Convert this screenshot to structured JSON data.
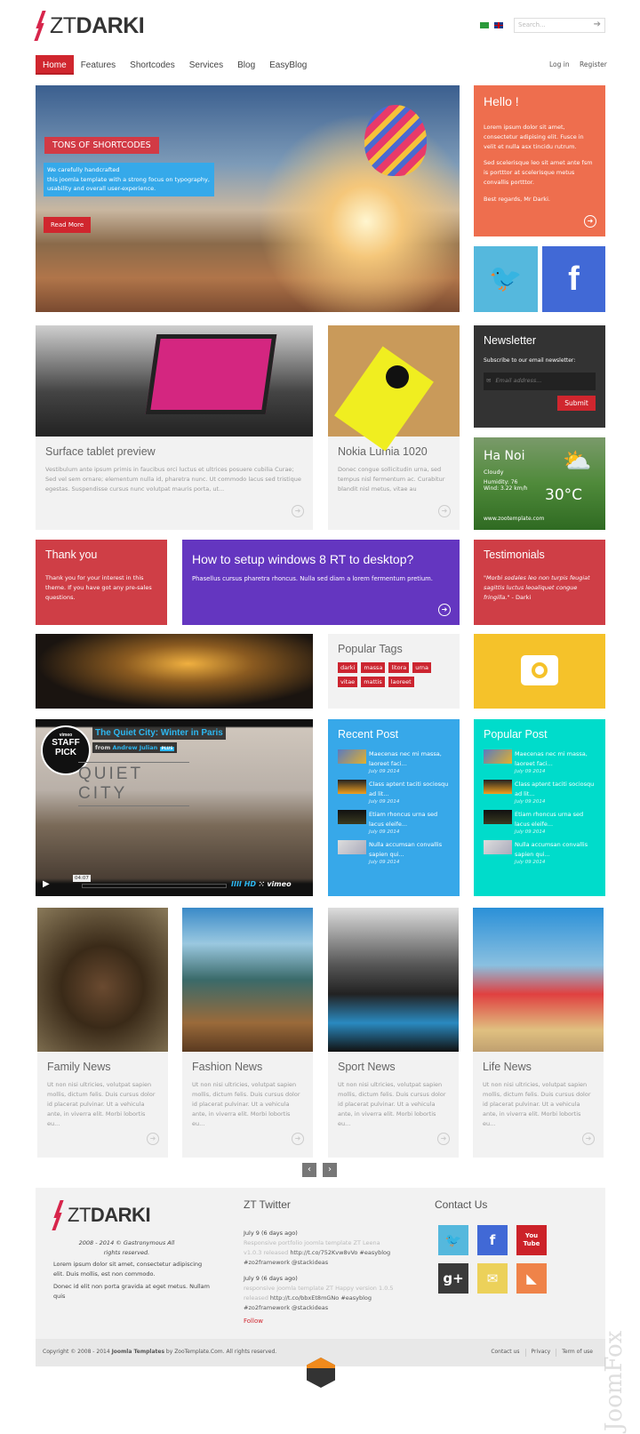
{
  "header": {
    "logo_light": "ZT",
    "logo_bold": "DARKI",
    "search_placeholder": "Search...",
    "flags": [
      "arabic-flag",
      "english-flag"
    ]
  },
  "nav": {
    "items": [
      "Home",
      "Features",
      "Shortcodes",
      "Services",
      "Blog",
      "EasyBlog"
    ],
    "active": "Home",
    "login": "Log in",
    "register": "Register"
  },
  "hero": {
    "badge": "TONS OF SHORTCODES",
    "caption_lines": [
      "We carefully handcrafted",
      "this joomla template with a strong focus on typography,",
      "usability and overall user-experience."
    ],
    "button": "Read More"
  },
  "hello": {
    "title": "Hello !",
    "p1": "Lorem ipsum dolor sit amet, consectetur adipising elit. Fusce in velit et nulla asx tincidu rutrum.",
    "p2": "Sed scelerisque leo sit amet ante fsm is portttor at scelerisque metus convallis portttor.",
    "p3": "Best regards, Mr Darki.",
    "color": "#ee6e4e"
  },
  "social": {
    "twitter_color": "#55b8dd",
    "facebook_color": "#4169d6"
  },
  "articles": [
    {
      "title": "Surface tablet preview",
      "text": "Vestibulum ante ipsum primis in faucibus orci luctus et ultrices posuere cubilia Curae; Sed vel sem ornare; elementum nulla id, pharetra nunc. Ut commodo lacus sed tristique egestas. Suspendisse cursus nunc volutpat mauris porta, ut..."
    },
    {
      "title": "Nokia Lumia 1020",
      "text": "Donec congue sollicitudin urna, sed tempus nisl fermentum ac. Curabitur blandit nisl metus, vitae au"
    }
  ],
  "newsletter": {
    "title": "Newsletter",
    "subtitle": "Subscribe to our email newsletter:",
    "placeholder": "Email address...",
    "submit": "Submit"
  },
  "weather": {
    "city": "Ha Noi",
    "condition": "Cloudy",
    "humidity": "Humidity: 76",
    "wind": "Wind: 3.22 km/h",
    "temp": "30°C",
    "site": "www.zootemplate.com"
  },
  "thankyou": {
    "title": "Thank you",
    "text": "Thank you for your interest in this theme. If you have got any pre-sales questions."
  },
  "howto": {
    "title": "How to setup windows 8 RT to desktop?",
    "text": "Phasellus cursus pharetra rhoncus. Nulla sed diam a lorem fermentum pretium."
  },
  "testimonials": {
    "title": "Testimonials",
    "quote": "\"Morbi sodales leo non turpis feugiat sagittis luctus leoaliquet congue fringilla.\"",
    "author": " - Darki"
  },
  "tags": {
    "title": "Popular Tags",
    "items": [
      "darki",
      "massa",
      "litora",
      "urna",
      "vitae",
      "mattis",
      "laoreet"
    ]
  },
  "video": {
    "title": "The Quiet City: Winter in Paris",
    "from": "from",
    "author": "Andrew Julian",
    "plus": "PLUS",
    "badge_top": "vimeo",
    "badge": "STAFF PICK",
    "overlay": "QUIET CITY",
    "time": "04:07",
    "hd": "HD",
    "brand": "vimeo"
  },
  "recent": {
    "title": "Recent Post",
    "items": [
      {
        "t": "Maecenas nec mi massa, laoreet faci...",
        "d": "July 09 2014"
      },
      {
        "t": "Class aptent taciti sociosqu ad lit...",
        "d": "July 09 2014"
      },
      {
        "t": "Etiam rhoncus urna sed lacus eleife...",
        "d": "July 09 2014"
      },
      {
        "t": "Nulla accumsan convallis sapien qui...",
        "d": "July 09 2014"
      }
    ]
  },
  "popular": {
    "title": "Popular Post",
    "items": [
      {
        "t": "Maecenas nec mi massa, laoreet faci...",
        "d": "July 09 2014"
      },
      {
        "t": "Class aptent taciti sociosqu ad lit...",
        "d": "July 09 2014"
      },
      {
        "t": "Etiam rhoncus urna sed lacus eleife...",
        "d": "July 09 2014"
      },
      {
        "t": "Nulla accumsan convallis sapien qui...",
        "d": "July 09 2014"
      }
    ]
  },
  "news": [
    {
      "title": "Family News",
      "text": "Ut non nisi ultricies, volutpat sapien mollis, dictum felis. Duis cursus dolor id placerat pulvinar. Ut a vehicula ante, in viverra elit. Morbi lobortis eu..."
    },
    {
      "title": "Fashion News",
      "text": "Ut non nisi ultricies, volutpat sapien mollis, dictum felis. Duis cursus dolor id placerat pulvinar. Ut a vehicula ante, in viverra elit. Morbi lobortis eu..."
    },
    {
      "title": "Sport News",
      "text": "Ut non nisi ultricies, volutpat sapien mollis, dictum felis. Duis cursus dolor id placerat pulvinar. Ut a vehicula ante, in viverra elit. Morbi lobortis eu..."
    },
    {
      "title": "Life News",
      "text": "Ut non nisi ultricies, volutpat sapien mollis, dictum felis. Duis cursus dolor id placerat pulvinar. Ut a vehicula ante, in viverra elit. Morbi lobortis eu..."
    }
  ],
  "pager": {
    "prev": "‹",
    "next": "›"
  },
  "footer": {
    "rights": "2008 - 2014 © Gastronymous All rights reserved.",
    "p1": "Lorem ipsum dolor sit amet, consectetur adipiscing elit. Duis mollis, est non commodo.",
    "p2": "Donec id elit non porta gravida at eget metus. Nullam quis",
    "twitter_title": "ZT Twitter",
    "tweets": [
      {
        "date": "July 9 (6 days ago)",
        "text": "Responsive portfolio joomla template ZT Leena v1.0.3 released",
        "link": "http://t.co/752Kvw8vVo #easyblog #zo2framework @stackideas"
      },
      {
        "date": "July 9 (6 days ago)",
        "text": "responsive joomla template ZT Happy version 1.0.5 released",
        "link": "http://t.co/bbxEt8mGNo #easyblog #zo2framework @stackideas"
      }
    ],
    "follow": "Follow",
    "contact_title": "Contact Us",
    "contact_icons": [
      {
        "name": "twitter",
        "glyph": "🐦",
        "color": "#55b8dd"
      },
      {
        "name": "facebook",
        "glyph": "f",
        "color": "#4169d6"
      },
      {
        "name": "youtube",
        "glyph": "You Tube",
        "color": "#cc2229"
      },
      {
        "name": "google-plus",
        "glyph": "g+",
        "color": "#3a3a3a"
      },
      {
        "name": "email",
        "glyph": "✉",
        "color": "#ecd15a"
      },
      {
        "name": "rss",
        "glyph": "◣",
        "color": "#ef8349"
      }
    ],
    "copyright_pre": "Copyright © 2008 - 2014 ",
    "copyright_bold": "Joomla Templates",
    "copyright_post": " by ZooTemplate.Com. All rights reserved.",
    "links": [
      "Contact us",
      "Privacy",
      "Term of use"
    ]
  },
  "watermark": "JoomFox"
}
